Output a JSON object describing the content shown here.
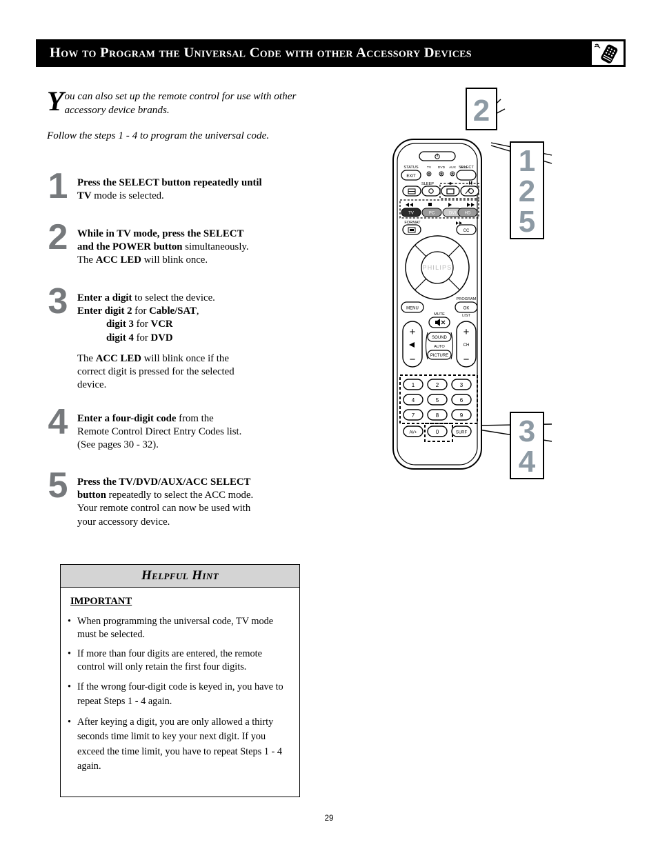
{
  "header": {
    "title": "How to Program the Universal Code with other Accessory Devices",
    "icon": "remote-control-icon"
  },
  "intro": {
    "dropcap": "Y",
    "line1": "ou can also set up the remote control for use with other",
    "line2": "accessory device brands.",
    "follow": "Follow the steps 1 - 4 to program the universal code."
  },
  "steps": [
    {
      "number": "1",
      "lines": [
        [
          {
            "t": "Press the SELECT button repeatedly until",
            "b": true
          }
        ],
        [
          {
            "t": "TV",
            "b": true
          },
          {
            "t": " mode is selected.",
            "b": false
          }
        ]
      ]
    },
    {
      "number": "2",
      "lines": [
        [
          {
            "t": "While in TV mode, press the SELECT",
            "b": true
          }
        ],
        [
          {
            "t": "and the POWER button",
            "b": true
          },
          {
            "t": " simultaneously.",
            "b": false
          }
        ],
        [
          {
            "t": "The ",
            "b": false
          },
          {
            "t": "ACC LED",
            "b": true
          },
          {
            "t": " will blink once.",
            "b": false
          }
        ]
      ]
    },
    {
      "number": "3",
      "lines": [
        [
          {
            "t": "Enter a digit",
            "b": true
          },
          {
            "t": " to select the device.",
            "b": false
          }
        ],
        [
          {
            "t": "Enter digit 2",
            "b": true
          },
          {
            "t": " for ",
            "b": false
          },
          {
            "t": "Cable/SAT",
            "b": true
          },
          {
            "t": ",",
            "b": false
          }
        ],
        [
          {
            "t": "digit 3",
            "b": true,
            "indent": true
          },
          {
            "t": " for ",
            "b": false
          },
          {
            "t": "VCR",
            "b": true
          }
        ],
        [
          {
            "t": "digit 4",
            "b": true,
            "indent": true
          },
          {
            "t": " for ",
            "b": false
          },
          {
            "t": "DVD",
            "b": true
          }
        ]
      ],
      "extra": [
        [
          {
            "t": "The ",
            "b": false
          },
          {
            "t": "ACC LED",
            "b": true
          },
          {
            "t": " will blink once if the",
            "b": false
          }
        ],
        [
          {
            "t": "correct digit is pressed for the selected",
            "b": false
          }
        ],
        [
          {
            "t": "device.",
            "b": false
          }
        ]
      ]
    },
    {
      "number": "4",
      "lines": [
        [
          {
            "t": "Enter a four-digit code",
            "b": true
          },
          {
            "t": " from the",
            "b": false
          }
        ],
        [
          {
            "t": "Remote Control Direct Entry Codes list.",
            "b": false
          }
        ],
        [
          {
            "t": "(See pages 30 - 32).",
            "b": false
          }
        ]
      ]
    },
    {
      "number": "5",
      "lines": [
        [
          {
            "t": "Press the TV/DVD/AUX/ACC SELECT",
            "b": true
          }
        ],
        [
          {
            "t": "button",
            "b": true
          },
          {
            "t": " repeatedly to select the ACC mode.",
            "b": false
          }
        ],
        [
          {
            "t": "Your remote control can now be used with",
            "b": false
          }
        ],
        [
          {
            "t": "your accessory device.",
            "b": false
          }
        ]
      ]
    }
  ],
  "hint": {
    "heading": "Helpful Hint",
    "important": "IMPORTANT",
    "bullet_char": "•",
    "bullets": [
      "When programming the universal code, TV mode must be selected.",
      "If more than four digits are entered, the remote control will only retain the first four digits.",
      "If the wrong four-digit code is keyed in, you have to repeat Steps 1 - 4 again.",
      "After keying a digit, you are only allowed a thirty seconds time limit to key your next digit. If you exceed the time limit, you have to repeat Steps 1 - 4 again."
    ]
  },
  "page_number": "29",
  "remote": {
    "brand": "PHILIPS",
    "callouts": [
      {
        "id": "callout-2",
        "values": [
          "2"
        ],
        "target": "power-button"
      },
      {
        "id": "callout-125",
        "values": [
          "1",
          "2",
          "5"
        ],
        "target": "select-button"
      },
      {
        "id": "callout-34",
        "values": [
          "3",
          "4"
        ],
        "target": "numeric-keypad"
      }
    ],
    "labels": {
      "status": "STATUS",
      "exit": "EXIT",
      "select": "SELECT",
      "sleep": "SLEEP",
      "format": "FORMAT",
      "cc": "CC",
      "menu": "MENU",
      "program": "PROGRAM",
      "ok": "OK",
      "mute": "MUTE",
      "list": "LIST",
      "ch": "CH",
      "sound": "SOUND",
      "auto": "AUTO",
      "picture": "PICTURE",
      "av_plus": "AV+",
      "surf": "SURF",
      "plus": "+",
      "minus": "−"
    },
    "led_labels": [
      "TV",
      "DVD",
      "AUX",
      "ACC"
    ],
    "mode_buttons": [
      "TV",
      "PC",
      "DVI",
      "HD"
    ],
    "digits": [
      "1",
      "2",
      "3",
      "4",
      "5",
      "6",
      "7",
      "8",
      "9"
    ],
    "zero": "0"
  },
  "colors": {
    "callout_number": "#8d9aa4",
    "step_number": "#76797c",
    "hint_header_bg": "#d4d4d4",
    "header_bg": "#000000"
  }
}
